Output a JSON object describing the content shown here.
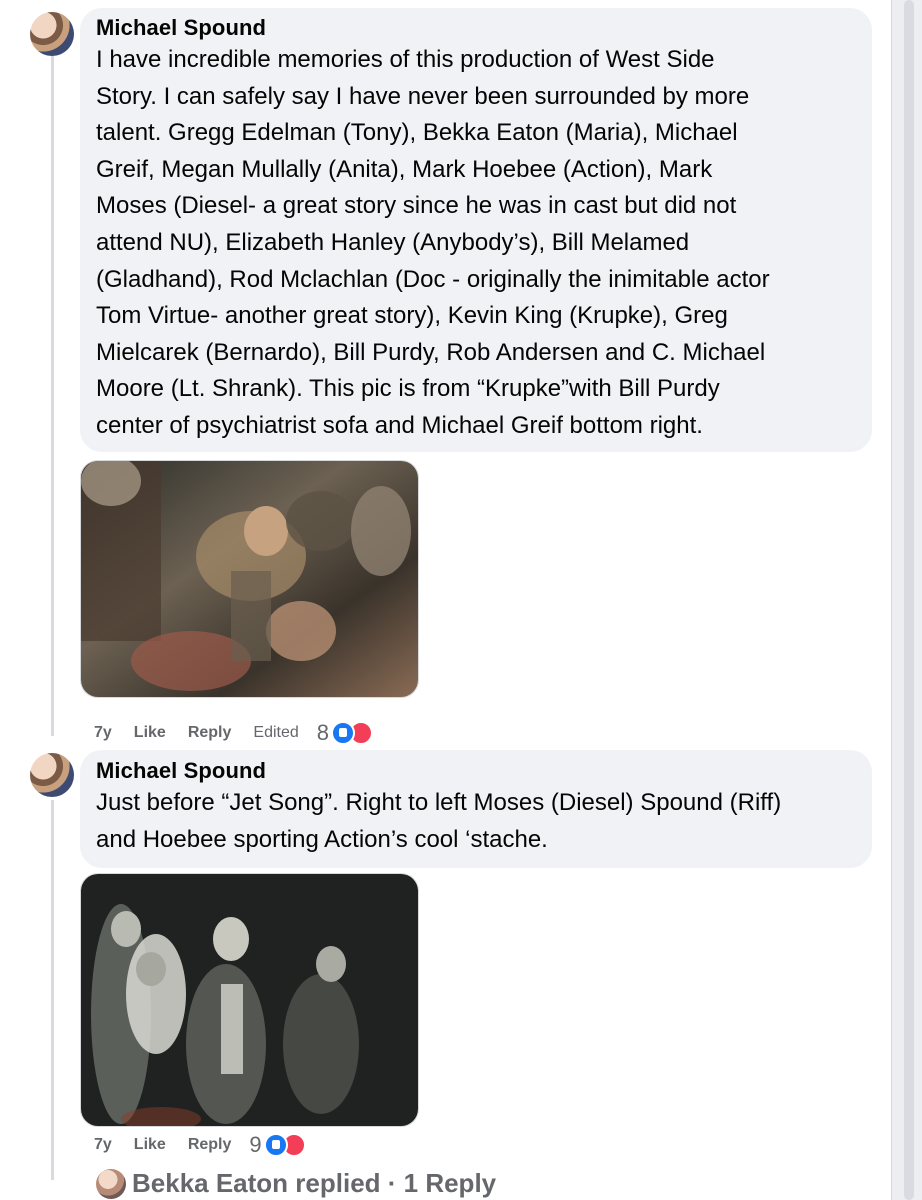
{
  "comments": [
    {
      "author": "Michael Spound",
      "text": "I have incredible memories of this production of West Side\nStory. I can safely say I have never been surrounded by more\ntalent. Gregg Edelman (Tony), Bekka Eaton (Maria), Michael\nGreif, Megan Mullally (Anita), Mark Hoebee (Action), Mark\nMoses (Diesel- a great story since he was in cast but did not\nattend NU), Elizabeth Hanley (Anybody’s), Bill Melamed\n(Gladhand), Rod Mclachlan (Doc - originally the inimitable actor\nTom Virtue- another great story), Kevin King (Krupke), Greg\nMielcarek (Bernardo), Bill Purdy, Rob Andersen and C. Michael\nMoore (Lt. Shrank). This pic is from “Krupke”with Bill Purdy\ncenter of psychiatrist sofa and Michael Greif bottom right.",
      "time": "7y",
      "like_label": "Like",
      "reply_label": "Reply",
      "edited_label": "Edited",
      "reaction_count": "8"
    },
    {
      "author": "Michael Spound",
      "text": "Just before “Jet Song”. Right to left Moses (Diesel) Spound (Riff)\nand Hoebee sporting Action’s cool ‘stache.",
      "time": "7y",
      "like_label": "Like",
      "reply_label": "Reply",
      "reaction_count": "9"
    }
  ],
  "replies_summary": "Bekka Eaton replied · 1 Reply",
  "colors": {
    "bubble": "#f0f2f5",
    "meta": "#65676b",
    "like": "#1877f2",
    "love": "#f33e58"
  }
}
